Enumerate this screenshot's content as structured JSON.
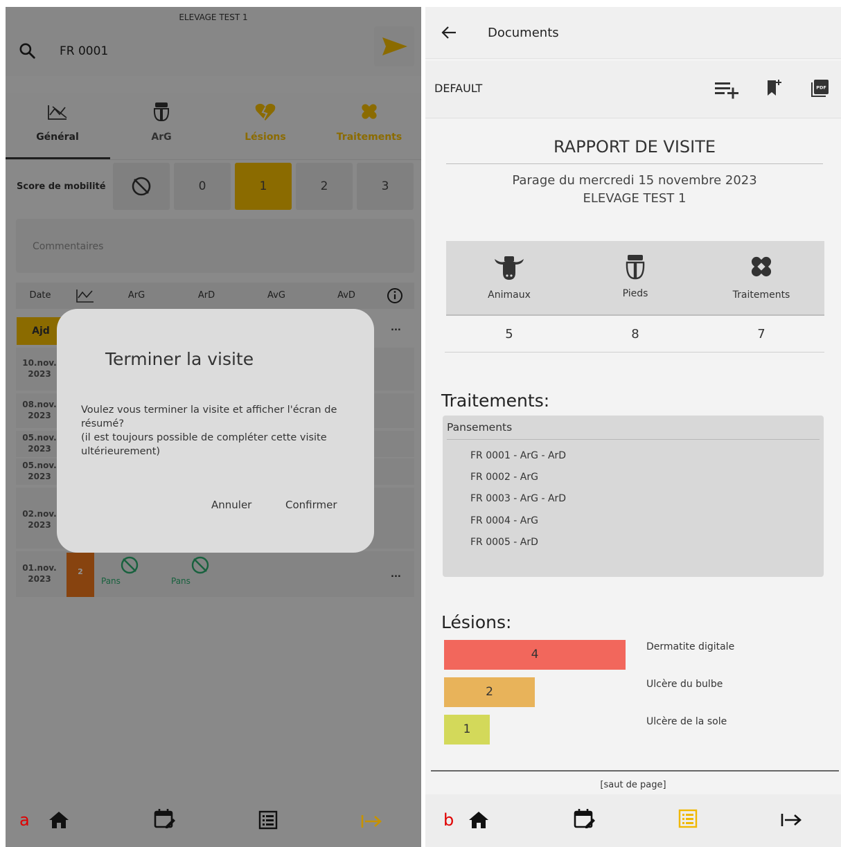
{
  "left": {
    "farm_title": "ELEVAGE TEST 1",
    "search_value": "FR 0001",
    "tabs": [
      {
        "label": "Général",
        "icon": "mobility-chart-icon"
      },
      {
        "label": "ArG",
        "icon": "hoof-icon"
      },
      {
        "label": "Lésions",
        "icon": "broken-heart-icon"
      },
      {
        "label": "Traitements",
        "icon": "bandage-icon"
      }
    ],
    "score_label": "Score de mobilité",
    "score_options": [
      "0",
      "1",
      "2",
      "3"
    ],
    "score_selected": "1",
    "comments_placeholder": "Commentaires",
    "grid_headers": [
      "Date",
      "ArG",
      "ArD",
      "AvG",
      "AvD"
    ],
    "rows": [
      {
        "date_line1": "Ajd",
        "date_line2": ""
      },
      {
        "date_line1": "10.nov.",
        "date_line2": "2023"
      },
      {
        "date_line1": "08.nov.",
        "date_line2": "2023"
      },
      {
        "date_line1": "05.nov.",
        "date_line2": "2023"
      },
      {
        "date_line1": "05.nov.",
        "date_line2": "2023"
      },
      {
        "date_line1": "02.nov.",
        "date_line2": "2023"
      },
      {
        "date_line1": "01.nov.",
        "date_line2": "2023"
      }
    ],
    "last_row": {
      "badge": "2",
      "arg_label": "Pans",
      "ard_label": "Pans"
    },
    "more_label": "...",
    "dialog": {
      "title": "Terminer la visite",
      "message_line1": "Voulez vous terminer la visite et afficher l'écran de",
      "message_line2": "résumé?",
      "message_line3": "(il est toujours possible de compléter cette visite",
      "message_line4": "ultérieurement)",
      "cancel_label": "Annuler",
      "confirm_label": "Confirmer"
    },
    "corner_label": "a"
  },
  "right": {
    "title": "Documents",
    "template_name": "DEFAULT",
    "report_title": "RAPPORT DE VISITE",
    "report_subtitle": "Parage du mercredi 15 novembre 2023",
    "report_farm": "ELEVAGE TEST 1",
    "stats": [
      {
        "label": "Animaux",
        "value": "5",
        "icon": "cow-icon"
      },
      {
        "label": "Pieds",
        "value": "8",
        "icon": "hoof-icon"
      },
      {
        "label": "Traitements",
        "value": "7",
        "icon": "bandage-icon"
      }
    ],
    "treatments_title": "Traitements:",
    "treatment_group": "Pansements",
    "treatment_items": [
      "FR 0001 - ArG - ArD",
      "FR 0002 - ArG",
      "FR 0003 - ArG - ArD",
      "FR 0004  - ArG",
      "FR 0005 - ArD"
    ],
    "lesions_title": "Lésions:",
    "lesions": [
      {
        "name": "Dermatite digitale",
        "count": 4,
        "color": "#f2675c"
      },
      {
        "name": "Ulcère du bulbe",
        "count": 2,
        "color": "#e8b35a"
      },
      {
        "name": "Ulcère de la sole",
        "count": 1,
        "color": "#d3d95a"
      }
    ],
    "page_break": "[saut de page]",
    "corner_label": "b"
  },
  "colors": {
    "accent": "#f0b800",
    "treatment_green": "#2aa86c",
    "alert_orange": "#e8741a"
  }
}
